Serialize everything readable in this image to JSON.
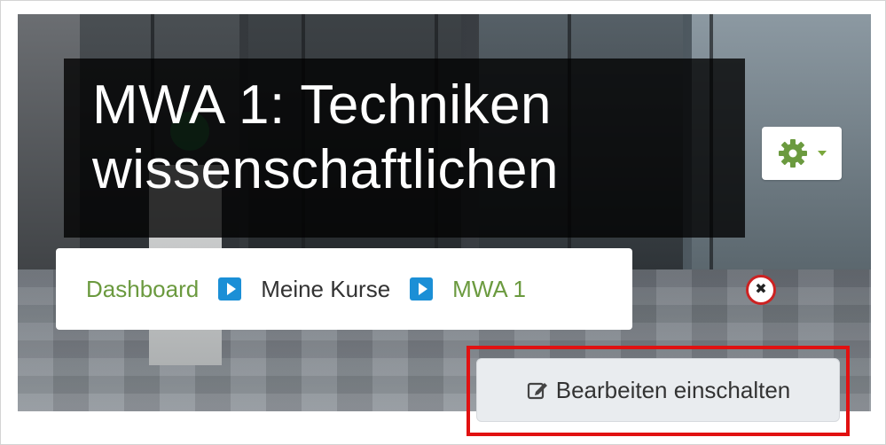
{
  "course": {
    "title_lines": [
      "MWA 1: Techniken",
      "wissenschaftlichen"
    ]
  },
  "settings_menu": {
    "icon": "gear-icon",
    "accent_color": "#6b9a3f"
  },
  "breadcrumb": {
    "items": [
      {
        "label": "Dashboard",
        "link": true
      },
      {
        "label": "Meine Kurse",
        "link": false
      },
      {
        "label": "MWA 1",
        "link": true
      }
    ],
    "separator_color": "#1b8fd6"
  },
  "edit_button": {
    "label": "Bearbeiten einschalten",
    "icon": "edit-icon",
    "highlight_color": "#e11111"
  }
}
